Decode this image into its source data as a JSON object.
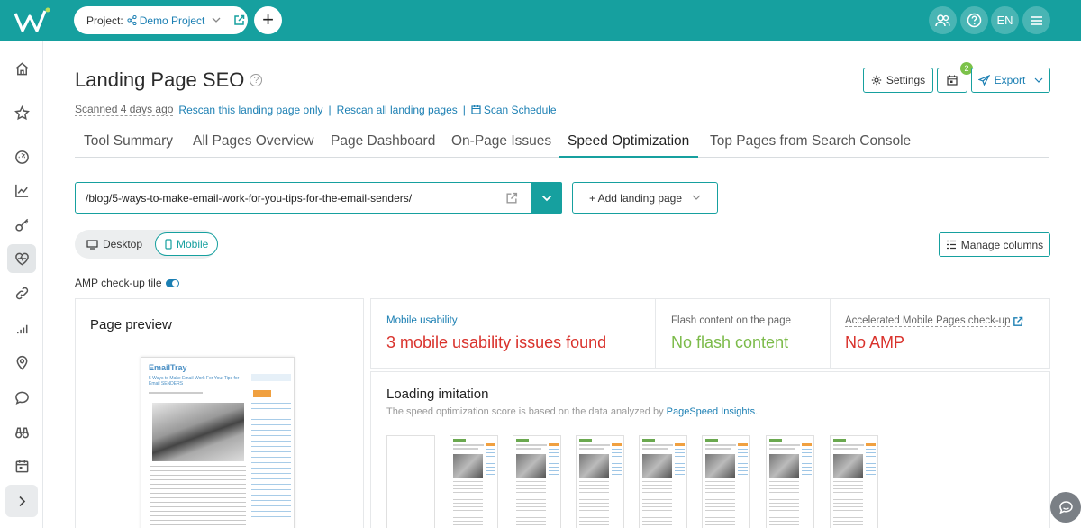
{
  "topbar": {
    "project_label": "Project:",
    "project_name": "Demo Project",
    "language": "EN",
    "icons": [
      "users-icon",
      "help-icon",
      "menu-icon"
    ]
  },
  "header": {
    "title": "Landing Page SEO",
    "scanned": "Scanned 4 days ago",
    "rescan_this": "Rescan this landing page only",
    "rescan_all": "Rescan all landing pages",
    "scan_schedule": "Scan Schedule",
    "separator": "|",
    "settings_label": "Settings",
    "export_label": "Export",
    "calendar_badge": "2"
  },
  "tabs": [
    {
      "label": "Tool Summary"
    },
    {
      "label": "All Pages Overview"
    },
    {
      "label": "Page Dashboard"
    },
    {
      "label": "On-Page Issues"
    },
    {
      "label": "Speed Optimization"
    },
    {
      "label": "Top Pages from Search Console"
    }
  ],
  "url_selector": {
    "value": "/blog/5-ways-to-make-email-work-for-you-tips-for-the-email-senders/",
    "add_label": "+ Add landing page"
  },
  "device_toggle": {
    "desktop": "Desktop",
    "mobile": "Mobile",
    "selected": "Mobile"
  },
  "manage_columns": "Manage columns",
  "amp_tile_label": "AMP check-up tile",
  "preview": {
    "title": "Page preview",
    "thumb_brand": "EmailTray",
    "thumb_heading": "5 Ways to Make Email Work For You: Tips for Email SENDERS"
  },
  "metrics": {
    "mobile_usability": {
      "label": "Mobile usability",
      "value": "3 mobile usability issues found",
      "color": "#d9322c"
    },
    "flash": {
      "label": "Flash content on the page",
      "value": "No flash content",
      "color": "#7cbb4a"
    },
    "amp": {
      "label": "Accelerated Mobile Pages check-up",
      "value": "No AMP",
      "color": "#d9322c"
    }
  },
  "loading": {
    "title": "Loading imitation",
    "subtitle_prefix": "The speed optimization score is based on the data analyzed by ",
    "subtitle_link": "PageSpeed Insights",
    "subtitle_suffix": "."
  },
  "colors": {
    "accent": "#16a09f",
    "link": "#1b7fb3"
  }
}
